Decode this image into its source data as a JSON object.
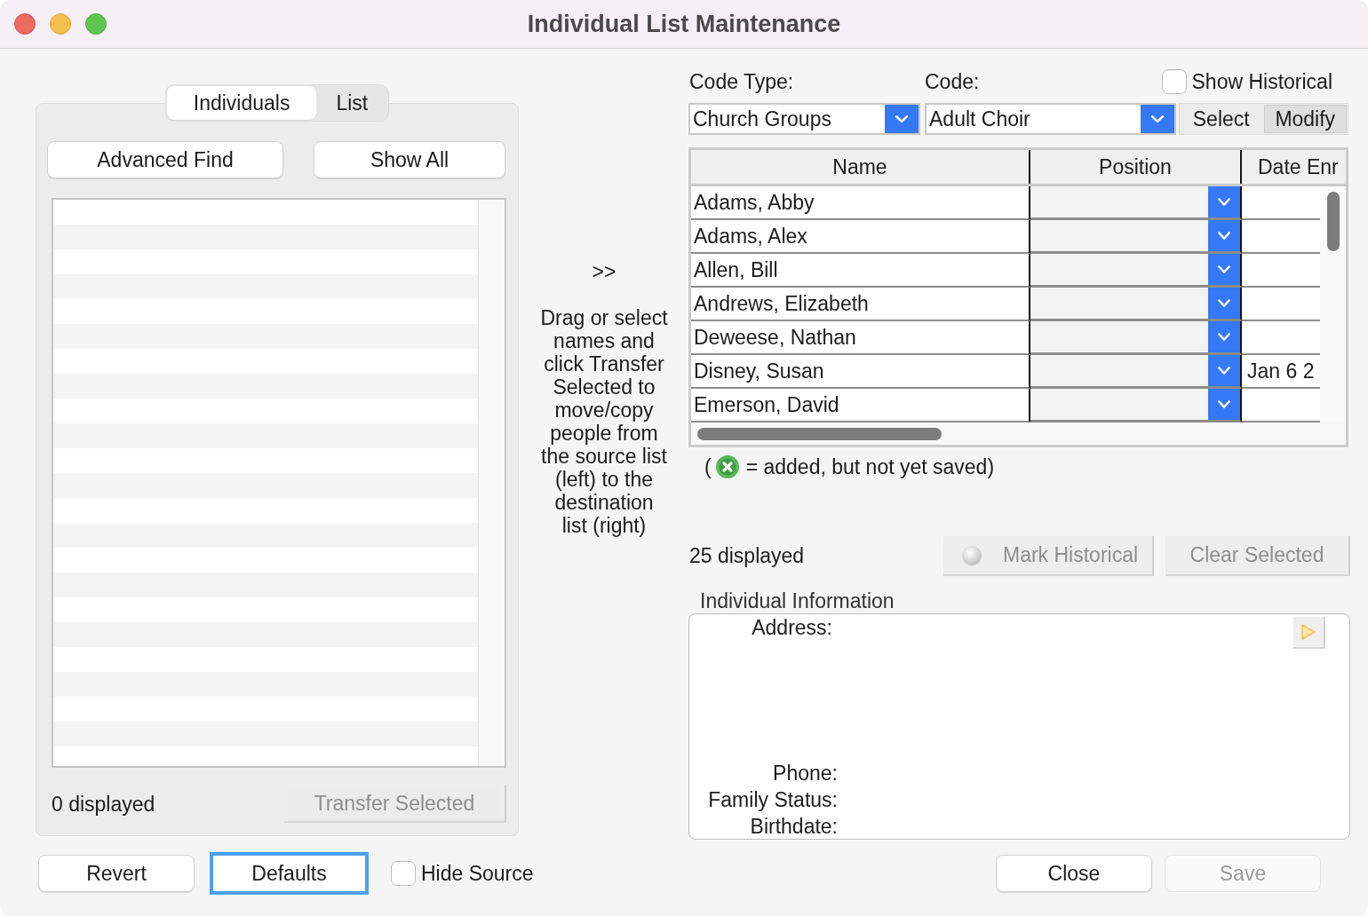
{
  "window": {
    "title": "Individual List Maintenance"
  },
  "source_panel": {
    "tabs": [
      {
        "label": "Individuals",
        "selected": true
      },
      {
        "label": "List",
        "selected": false
      }
    ],
    "buttons": [
      {
        "label": "Advanced Find"
      },
      {
        "label": "Show All"
      }
    ],
    "status": "0 displayed",
    "transfer_button": {
      "label": "Transfer Selected",
      "disabled": true
    }
  },
  "transfer_help": {
    "arrow": ">>",
    "text": "Drag or select names and click Transfer Selected to move/copy people from the source list (left) to the destination list (right)"
  },
  "destination_panel": {
    "code_type": {
      "label": "Code Type:",
      "value": "Church Groups"
    },
    "code": {
      "label": "Code:",
      "value": "Adult Choir"
    },
    "show_historical": {
      "label": "Show Historical",
      "checked": false
    },
    "mode_buttons": [
      {
        "label": "Select",
        "selected": false
      },
      {
        "label": "Modify",
        "selected": true
      }
    ],
    "table": {
      "columns": [
        "Name",
        "Position",
        "Date Enr"
      ],
      "rows": [
        {
          "name": "Adams, Abby"
        },
        {
          "name": "Adams, Alex"
        },
        {
          "name": "Allen, Bill"
        },
        {
          "name": "Andrews, Elizabeth"
        },
        {
          "name": "Deweese, Nathan"
        },
        {
          "name": "Disney, Susan",
          "column_3": "Jan 6 2"
        },
        {
          "name": "Emerson, David"
        }
      ]
    },
    "legend": {
      "open": "(",
      "text": "= added, but not yet saved)"
    },
    "status": "25 displayed",
    "actions": [
      {
        "label": "Mark Historical",
        "kind": "status",
        "disabled": true
      },
      {
        "label": "Clear Selected",
        "kind": "plain",
        "disabled": true
      }
    ],
    "individual_info": {
      "title": "Individual Information",
      "fields": [
        {
          "label": "Address:",
          "kind": "multiline"
        },
        {
          "label": "Phone:",
          "kind": "line"
        },
        {
          "label": "Family Status:",
          "kind": "line"
        },
        {
          "label": "Birthdate:",
          "kind": "line"
        }
      ]
    }
  },
  "footer": {
    "left_buttons": [
      {
        "label": "Revert",
        "focused": false
      },
      {
        "label": "Defaults",
        "focused": true
      }
    ],
    "hide_source": {
      "label": "Hide Source",
      "checked": false
    },
    "right_buttons": [
      {
        "label": "Close",
        "disabled": false
      },
      {
        "label": "Save",
        "disabled": true
      }
    ]
  }
}
